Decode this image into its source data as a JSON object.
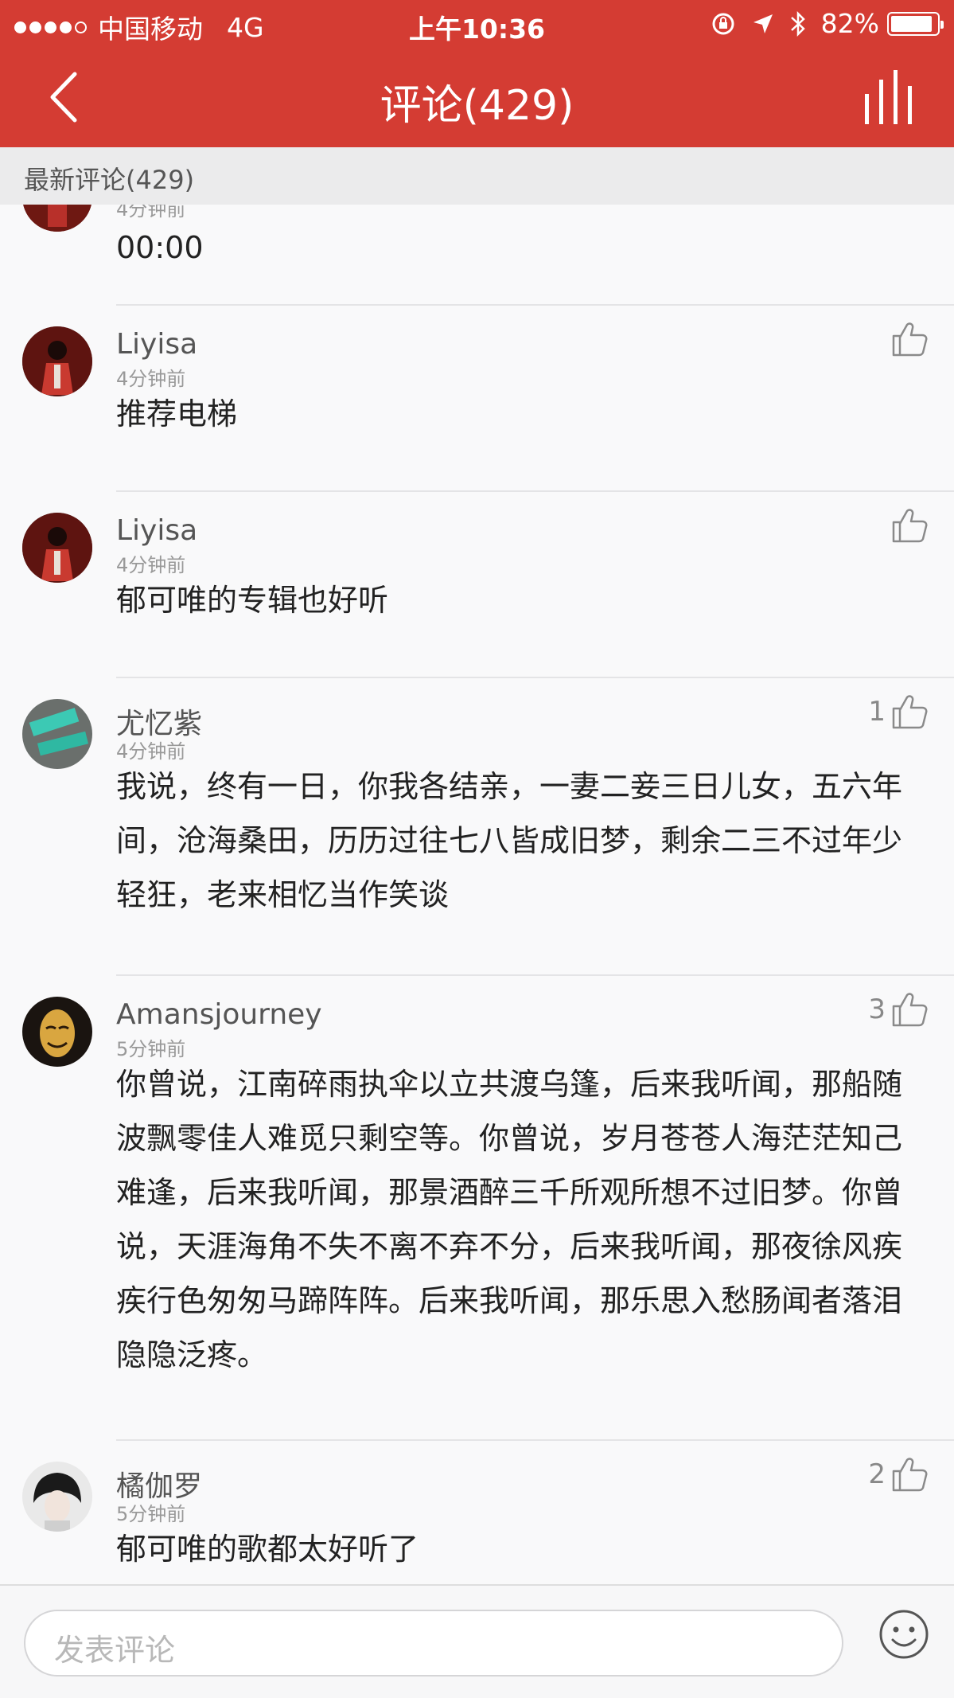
{
  "status_bar": {
    "carrier": "中国移动",
    "network": "4G",
    "time": "上午10:36",
    "battery": "82%",
    "battery_level": 0.82
  },
  "nav": {
    "title": "评论(429)",
    "back_icon": "chevron-left-icon",
    "chart_icon": "bar-chart-icon"
  },
  "section": {
    "title": "最新评论(429)"
  },
  "comments": [
    {
      "text": "00:00",
      "time_partial": "4分钟前"
    },
    {
      "user": "Liyisa",
      "time": "4分钟前",
      "text": "推荐电梯",
      "likes": ""
    },
    {
      "user": "Liyisa",
      "time": "4分钟前",
      "text": "郁可唯的专辑也好听",
      "likes": ""
    },
    {
      "user": "尤忆紫",
      "time": "4分钟前",
      "text": "我说，终有一日，你我各结亲，一妻二妾三日儿女，五六年间，沧海桑田，历历过往七八皆成旧梦，剩余二三不过年少轻狂，老来相忆当作笑谈",
      "likes": "1"
    },
    {
      "user": "Amansjourney",
      "time": "5分钟前",
      "text": "你曾说，江南碎雨执伞以立共渡乌篷，后来我听闻，那船随波飘零佳人难觅只剩空等。你曾说，岁月苍苍人海茫茫知己难逢，后来我听闻，那景酒醉三千所观所想不过旧梦。你曾说，天涯海角不失不离不弃不分，后来我听闻，那夜徐风疾疾行色匆匆马蹄阵阵。后来我听闻，那乐思入愁肠闻者落泪隐隐泛疼。",
      "likes": "3"
    },
    {
      "user": "橘伽罗",
      "time": "5分钟前",
      "text": "郁可唯的歌都太好听了",
      "likes": "2"
    }
  ],
  "composer": {
    "placeholder": "发表评论",
    "emoji_icon": "smiley-icon"
  },
  "colors": {
    "brand_red": "#d43c33",
    "background": "#f9f9fa"
  }
}
